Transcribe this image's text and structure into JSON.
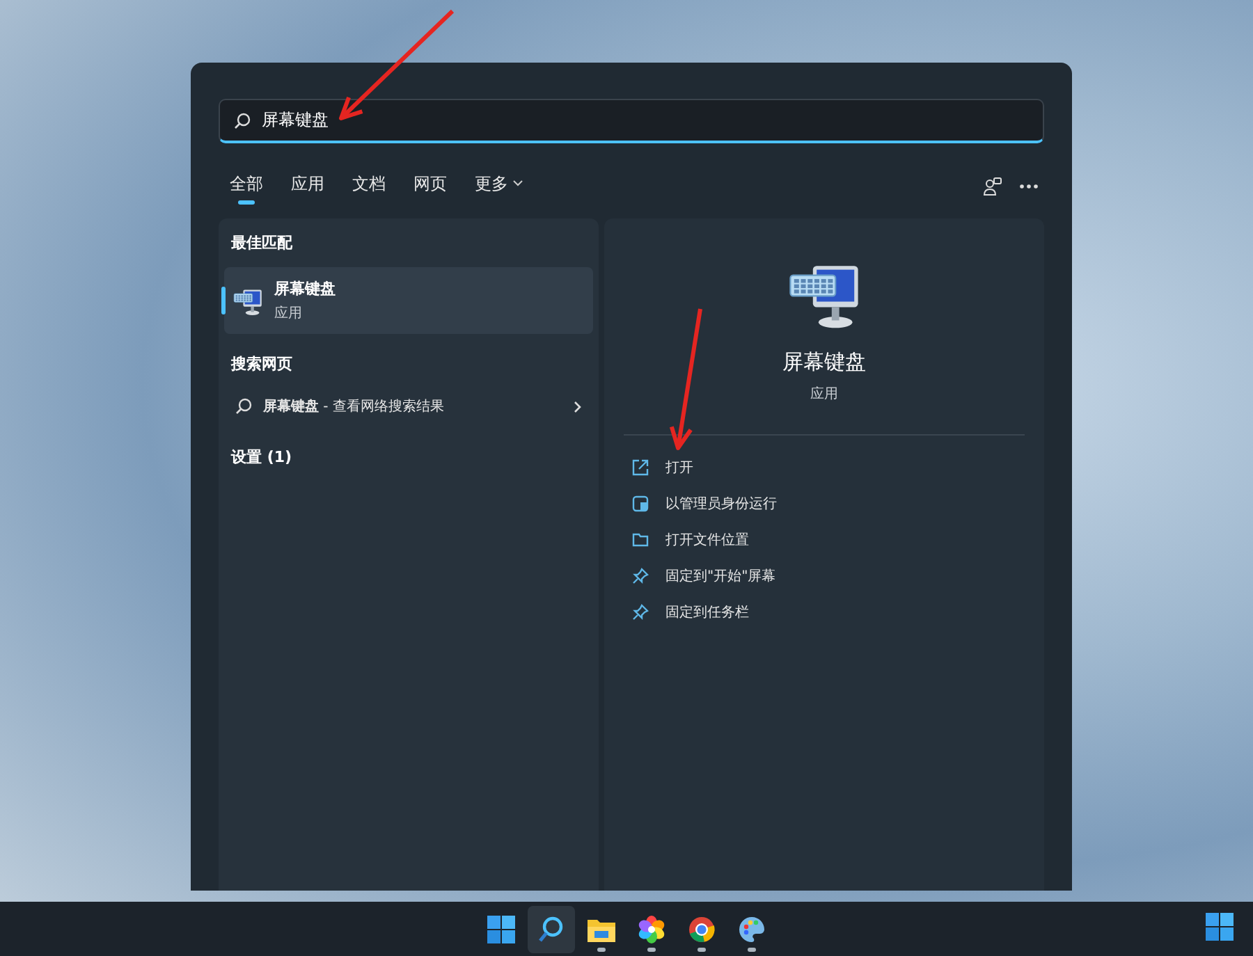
{
  "search": {
    "value": "屏幕键盘"
  },
  "tabs": [
    {
      "label": "全部",
      "selected": true
    },
    {
      "label": "应用",
      "selected": false
    },
    {
      "label": "文档",
      "selected": false
    },
    {
      "label": "网页",
      "selected": false
    },
    {
      "label": "更多",
      "selected": false,
      "dropdown": true
    }
  ],
  "best_match": {
    "heading": "最佳匹配",
    "title": "屏幕键盘",
    "subtitle": "应用",
    "selected": true
  },
  "web_search": {
    "heading": "搜索网页",
    "query": "屏幕键盘",
    "hint": " - 查看网络搜索结果"
  },
  "settings": {
    "heading": "设置 (1)"
  },
  "detail": {
    "title": "屏幕键盘",
    "subtitle": "应用",
    "actions": [
      {
        "kind": "open",
        "label": "打开"
      },
      {
        "kind": "admin",
        "label": "以管理员身份运行"
      },
      {
        "kind": "folder",
        "label": "打开文件位置"
      },
      {
        "kind": "pin",
        "label": "固定到\"开始\"屏幕"
      },
      {
        "kind": "pin",
        "label": "固定到任务栏"
      }
    ]
  },
  "taskbar": [
    {
      "kind": "start",
      "selected": false,
      "running": false
    },
    {
      "kind": "search",
      "selected": true,
      "running": false
    },
    {
      "kind": "folder",
      "selected": false,
      "running": true
    },
    {
      "kind": "photos",
      "selected": false,
      "running": true
    },
    {
      "kind": "browser",
      "selected": false,
      "running": true
    },
    {
      "kind": "paint",
      "selected": false,
      "running": true
    }
  ]
}
